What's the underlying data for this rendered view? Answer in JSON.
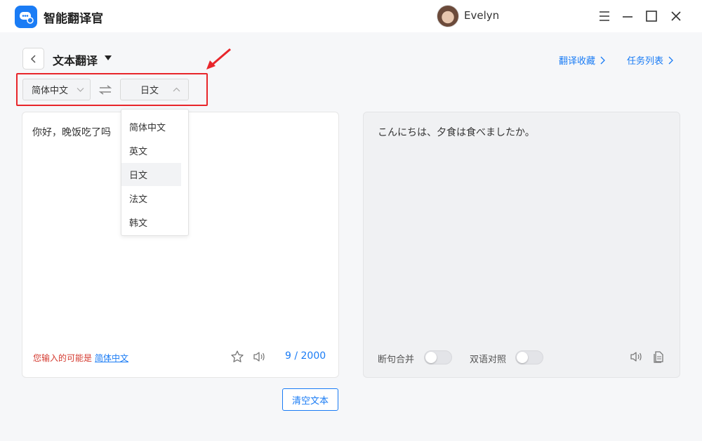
{
  "app": {
    "title": "智能翻译官",
    "user": "Evelyn",
    "icons": [
      "chat-logo-icon",
      "menu-icon",
      "minimize-icon",
      "maximize-icon",
      "close-icon"
    ]
  },
  "header": {
    "title": "文本翻译",
    "links": {
      "favorites": "翻译收藏",
      "tasks": "任务列表"
    }
  },
  "languages": {
    "source": "简体中文",
    "target": "日文",
    "dropdown_open": true,
    "options": [
      "简体中文",
      "英文",
      "日文",
      "法文",
      "韩文"
    ],
    "selected_index": 2
  },
  "source_panel": {
    "text": "你好，晚饭吃了吗",
    "detect_prefix": "您输入的可能是",
    "detect_lang": "简体中文",
    "count": "9 / 2000"
  },
  "target_panel": {
    "text": "こんにちは、夕食は食べましたか。",
    "toggle1_label": "断句合并",
    "toggle2_label": "双语对照"
  },
  "actions": {
    "clear": "清空文本"
  },
  "colors": {
    "accent": "#1a7cf5",
    "highlight": "#e8262b",
    "detect": "#d43a2f"
  }
}
